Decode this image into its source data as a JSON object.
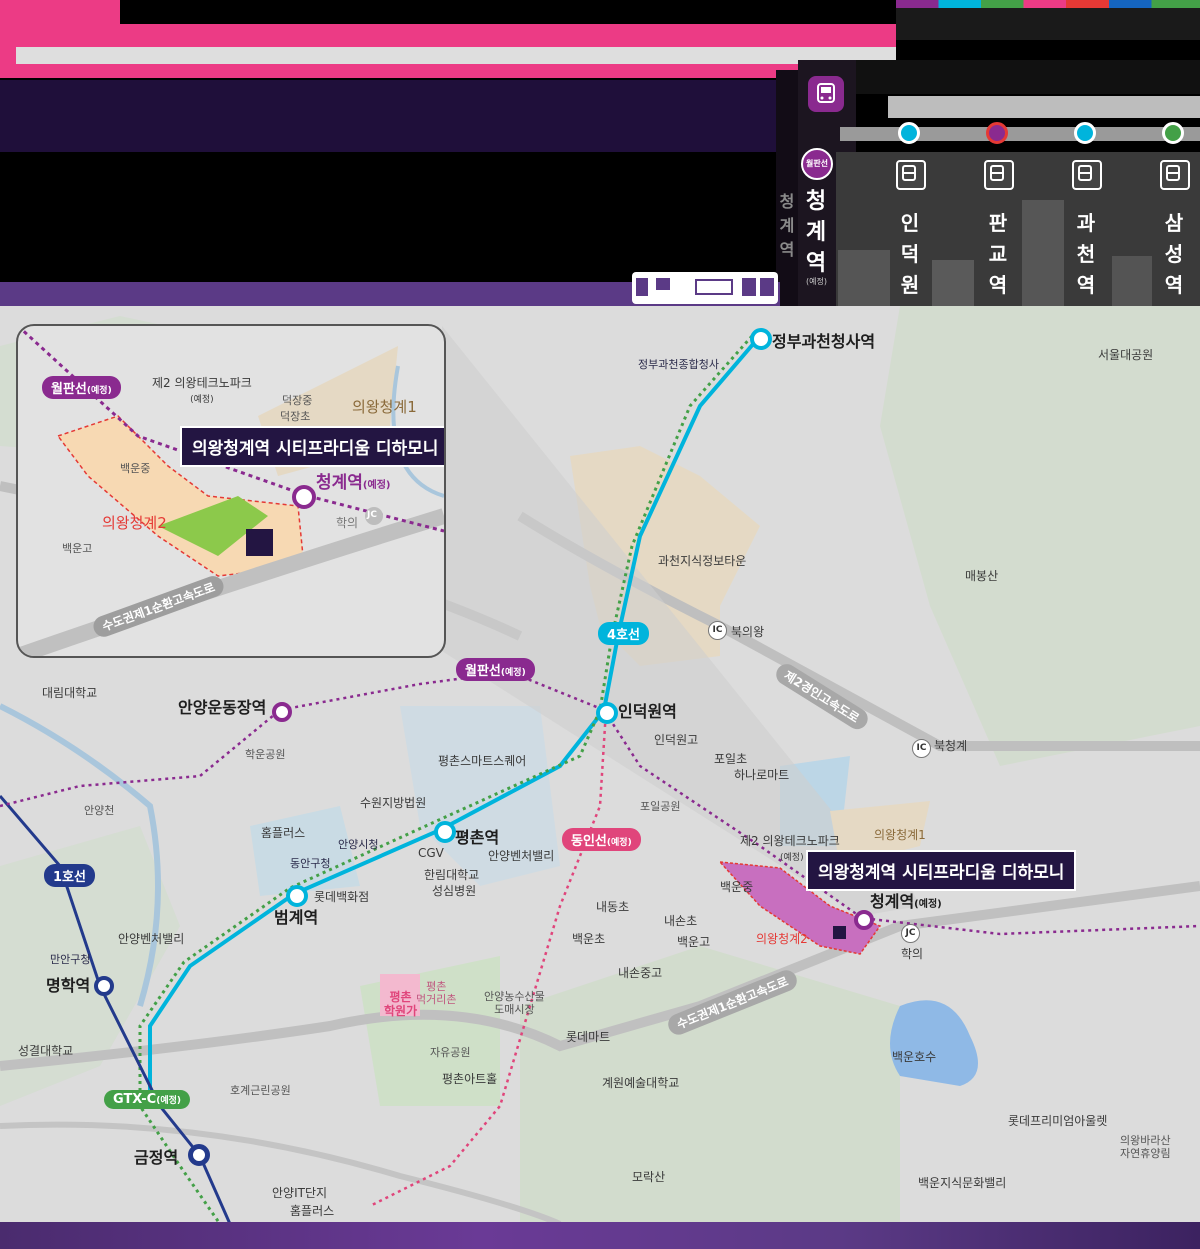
{
  "colors": {
    "purple_line": "#8a2a8f",
    "line4": "#00b4dc",
    "gtx": "#43a047",
    "line1": "#233a8c",
    "dongin": "#e0457b",
    "pink": "#ec3b85",
    "dark": "#231542"
  },
  "header": {
    "banner_bar": "",
    "sub_bar": ""
  },
  "tower": {
    "main_station": [
      "청",
      "계",
      "역"
    ],
    "main_note": "(예정)",
    "badge": "월판선",
    "side_station": [
      "청",
      "계",
      "역"
    ],
    "columns": [
      {
        "name": [
          "인",
          "덕",
          "원",
          "역"
        ],
        "color": "#00b4dc"
      },
      {
        "name": [
          "판",
          "교",
          "역"
        ],
        "color": "#8a2a8f"
      },
      {
        "name": [
          "과",
          "천",
          "역"
        ],
        "color": "#00b4dc"
      },
      {
        "name": [
          "삼",
          "성",
          "역"
        ],
        "color": "#43a047"
      }
    ]
  },
  "map": {
    "stations": {
      "jeongbu": "정부과천청사역",
      "indeogwon": "인덕원역",
      "pyeongchon": "평촌역",
      "beomgye": "범계역",
      "anyang_undong": "안양운동장역",
      "myeonghak": "명학역",
      "geumjeong": "금정역",
      "cheonggye": "청계역",
      "cheonggye_note": "(예정)"
    },
    "lines": {
      "line4": "4호선",
      "wolpan": "월판선",
      "wolpan_note": "(예정)",
      "dongin": "동인선",
      "dongin_note": "(예정)",
      "line1": "1호선",
      "gtx": "GTX-C",
      "gtx_note": "(예정)"
    },
    "roads": {
      "gyeongin2": "제2경인고속도로",
      "ring1": "수도권제1순환고속도로"
    },
    "ic": {
      "bukuiwang": "북의왕",
      "bukcheonggye": "북청계",
      "hagui": "학의",
      "ic": "IC",
      "jc": "JC"
    },
    "pois": {
      "gov_complex": "정부과천종합청사",
      "seoul_park": "서울대공원",
      "gwacheon_town": "과천지식정보타운",
      "maebongsan": "매봉산",
      "daerim": "대림대학교",
      "hakun_park": "학운공원",
      "pyeongchon_smart": "평촌스마트스퀘어",
      "indeogwon_hs": "인덕원고",
      "poil_cho": "포일초",
      "hanaro": "하나로마트",
      "poil_park": "포일공원",
      "suwon_court": "수원지방법원",
      "homeplus1": "홈플러스",
      "anyang_cityhall": "안양시청",
      "dongan_office": "동안구청",
      "cgv": "CGV",
      "anyang_valley": "안양벤처밸리",
      "hallym": "한림대학교",
      "hallym2": "성심병원",
      "lotte_dept": "롯데백화점",
      "anyangcheon": "안양천",
      "anyang_valley2": "안양벤처밸리",
      "manan_office": "만안구청",
      "naedong": "내동초",
      "naeson": "내손초",
      "baegun_cho": "백운초",
      "baegun_go": "백운고",
      "naeson_jung": "내손중고",
      "baegun_jung": "백운중",
      "techno2": "제2 의왕테크노파크",
      "techno2_note": "(예정)",
      "cheonggye1": "의왕청계1",
      "cheonggye2": "의왕청계2",
      "pyeongchon_academy1": "평촌",
      "pyeongchon_academy2": "학원가",
      "pyeongchon_food1": "평촌",
      "pyeongchon_food2": "먹거리촌",
      "agri_market1": "안양농수산물",
      "agri_market2": "도매시장",
      "lotte_mart": "롯데마트",
      "jayu_park": "자유공원",
      "pyeongchon_art": "평촌아트홀",
      "seonggyeol": "성결대학교",
      "hogye_park": "호계근린공원",
      "gyewon": "계원예술대학교",
      "baegun_lake": "백운호수",
      "lotte_outlet": "롯데프리미엄아울렛",
      "uiwang_forest1": "의왕바라산",
      "uiwang_forest2": "자연휴양림",
      "morak": "모락산",
      "baegun_valley": "백운지식문화밸리",
      "anyang_it": "안양IT단지",
      "homeplus2": "홈플러스"
    },
    "callout": "의왕청계역 시티프라디움 디하모니"
  },
  "inset": {
    "wolpan": "월판선",
    "wolpan_note": "(예정)",
    "techno2": "제2 의왕테크노파크",
    "techno2_note": "(예정)",
    "deokjang_jung": "덕장중",
    "deokjang_cho": "덕장초",
    "cheonggye1": "의왕청계1",
    "callout": "의왕청계역 시티프라디움 디하모니",
    "baegun_jung": "백운중",
    "cheonggye_station": "청계역",
    "cheonggye_note": "(예정)",
    "hagui": "학의",
    "jc": "JC",
    "cheonggye2": "의왕청계2",
    "baegun_go": "백운고",
    "ring1": "수도권제1순환고속도로"
  }
}
